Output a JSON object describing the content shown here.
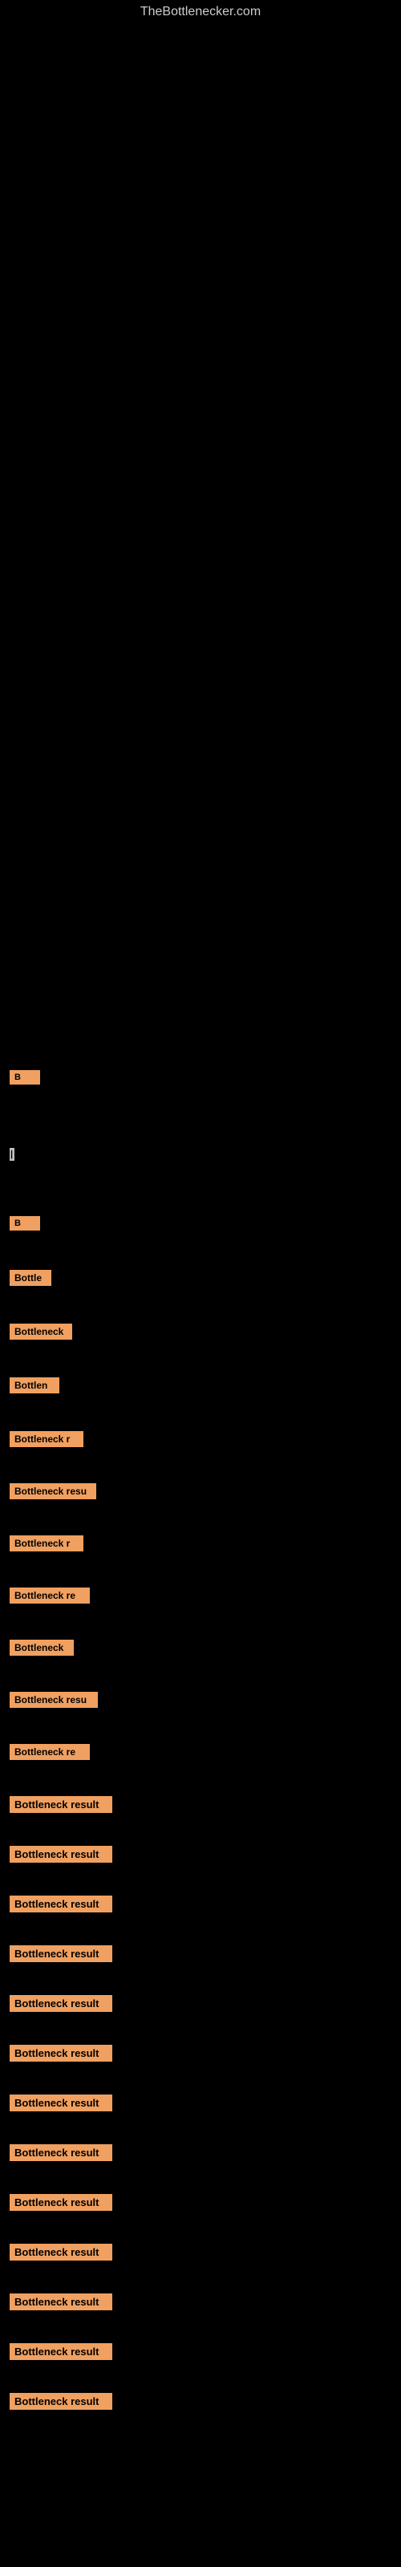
{
  "site": {
    "title": "TheBottlenecker.com"
  },
  "rows": [
    {
      "id": 1,
      "label": "B",
      "class": "row-1",
      "visible": true
    },
    {
      "id": 2,
      "label": "|",
      "class": "row-2",
      "visible": true
    },
    {
      "id": 3,
      "label": "B",
      "class": "row-3",
      "visible": true
    },
    {
      "id": 4,
      "label": "Bottle",
      "class": "row-4",
      "visible": true
    },
    {
      "id": 5,
      "label": "Bottleneck",
      "class": "row-5",
      "visible": true
    },
    {
      "id": 6,
      "label": "Bottlen",
      "class": "row-6",
      "visible": true
    },
    {
      "id": 7,
      "label": "Bottleneck r",
      "class": "row-7",
      "visible": true
    },
    {
      "id": 8,
      "label": "Bottleneck resu",
      "class": "row-8",
      "visible": true
    },
    {
      "id": 9,
      "label": "Bottleneck r",
      "class": "row-9",
      "visible": true
    },
    {
      "id": 10,
      "label": "Bottleneck re",
      "class": "row-10",
      "visible": true
    },
    {
      "id": 11,
      "label": "Bottleneck",
      "class": "row-11",
      "visible": true
    },
    {
      "id": 12,
      "label": "Bottleneck resu",
      "class": "row-12",
      "visible": true
    },
    {
      "id": 13,
      "label": "Bottleneck re",
      "class": "row-13",
      "visible": true
    },
    {
      "id": 14,
      "label": "Bottleneck result",
      "class": "row-14",
      "visible": true
    },
    {
      "id": 15,
      "label": "Bottleneck result",
      "class": "row-15",
      "visible": true
    },
    {
      "id": 16,
      "label": "Bottleneck result",
      "class": "row-16",
      "visible": true
    },
    {
      "id": 17,
      "label": "Bottleneck result",
      "class": "row-17",
      "visible": true
    },
    {
      "id": 18,
      "label": "Bottleneck result",
      "class": "row-18",
      "visible": true
    },
    {
      "id": 19,
      "label": "Bottleneck result",
      "class": "row-19",
      "visible": true
    },
    {
      "id": 20,
      "label": "Bottleneck result",
      "class": "row-20",
      "visible": true
    },
    {
      "id": 21,
      "label": "Bottleneck result",
      "class": "row-21",
      "visible": true
    },
    {
      "id": 22,
      "label": "Bottleneck result",
      "class": "row-22",
      "visible": true
    },
    {
      "id": 23,
      "label": "Bottleneck result",
      "class": "row-23",
      "visible": true
    },
    {
      "id": 24,
      "label": "Bottleneck result",
      "class": "row-24",
      "visible": true
    },
    {
      "id": 25,
      "label": "Bottleneck result",
      "class": "row-25",
      "visible": true
    },
    {
      "id": 26,
      "label": "Bottleneck result",
      "class": "row-26",
      "visible": true
    }
  ]
}
